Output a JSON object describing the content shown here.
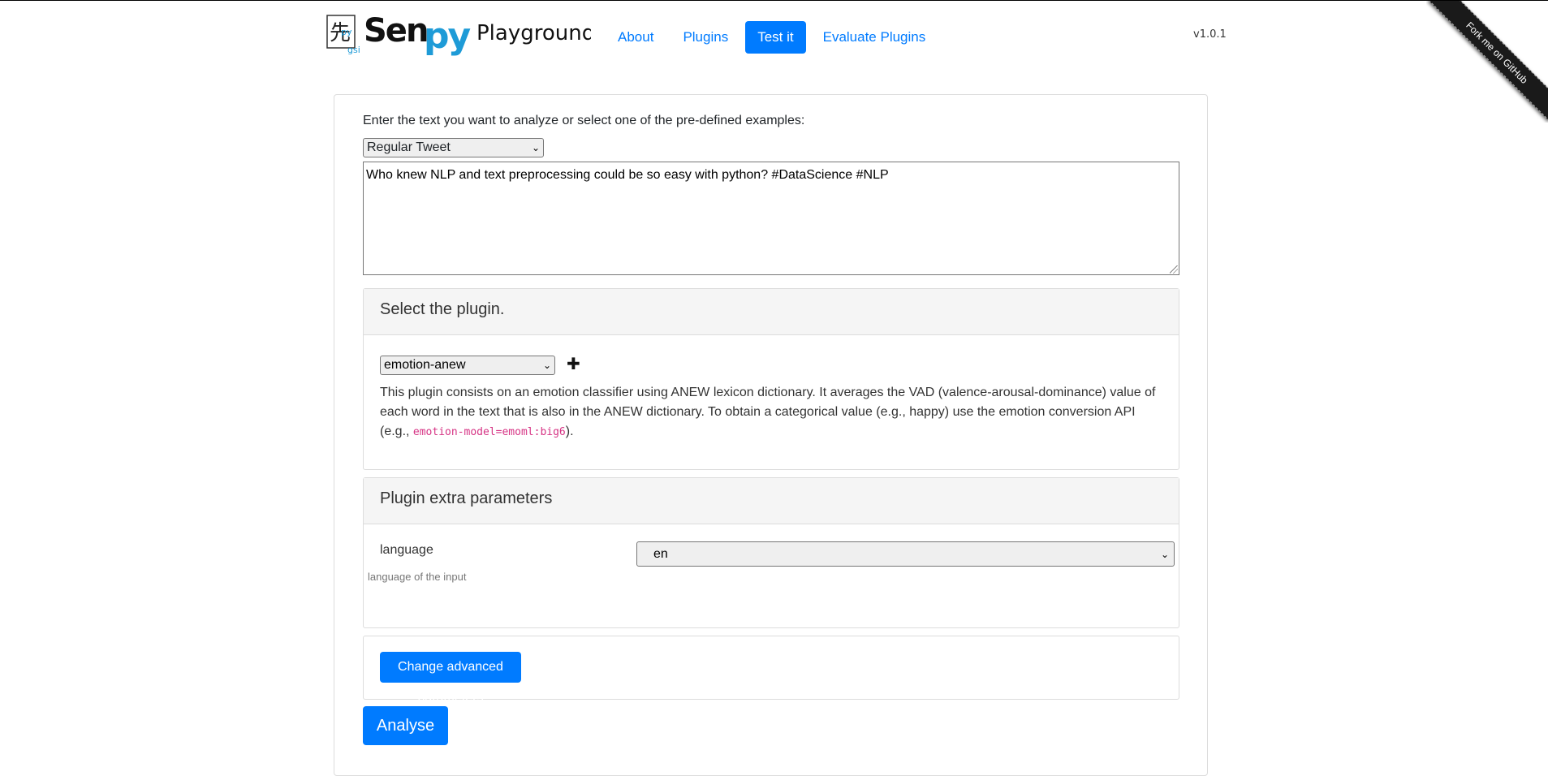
{
  "header": {
    "logo_text": "Senpy",
    "logo_subtext": "Playground",
    "logo_badge": "gsi",
    "nav": [
      {
        "label": "About"
      },
      {
        "label": "Plugins"
      },
      {
        "label": "Test it",
        "active": true
      },
      {
        "label": "Evaluate Plugins"
      }
    ],
    "version": "v1.0.1",
    "ribbon": "Fork me on GitHub"
  },
  "form": {
    "intro": "Enter the text you want to analyze or select one of the pre-defined examples:",
    "example_selected": "Regular Tweet",
    "text_value": "Who knew NLP and text preprocessing could be so easy with python? #DataScience #NLP"
  },
  "plugin": {
    "heading": "Select the plugin.",
    "selected": "emotion-anew",
    "description_main": "This plugin consists on an emotion classifier using ANEW lexicon dictionary. It averages the VAD (valence-arousal-dominance) value of each word in the text that is also in the ANEW dictionary. To obtain a categorical value (e.g., happy) use the emotion conversion API (e.g., ",
    "description_code": "emotion-model=emoml:big6",
    "description_end": ")."
  },
  "params": {
    "heading": "Plugin extra parameters",
    "name": "language",
    "help": "language of the input",
    "value": "en"
  },
  "actions": {
    "advanced": "Change advanced parameters",
    "analyse": "Analyse"
  },
  "colors": {
    "accent": "#007bff",
    "code": "#d63384",
    "logo_blue": "#1e9bd7"
  }
}
